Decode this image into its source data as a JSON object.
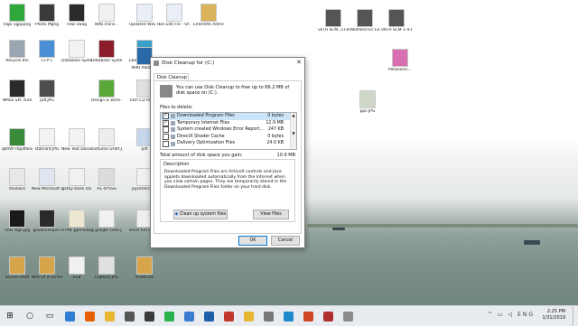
{
  "desktop": {
    "icons": [
      {
        "label": "logo vgpppng",
        "color": "#2ea83a"
      },
      {
        "label": "Photo Mgng",
        "color": "#3a3a3a"
      },
      {
        "label": "new vwag",
        "color": "#2b2b2b"
      },
      {
        "label": "WIKI.trans...",
        "color": "#f0f0f0"
      },
      {
        "label": "Updated Wiki File Name",
        "color": "#e9eef7"
      },
      {
        "label": "Do Edit Fle - Shortcut",
        "color": "#e9eef7"
      },
      {
        "label": "Enterkfts Admin ...",
        "color": "#d9b45a"
      },
      {
        "label": "Recycle Bin",
        "color": "#9aa6b2"
      },
      {
        "label": "CCP C",
        "color": "#4a8ed6"
      },
      {
        "label": "Database System.Srcs",
        "color": "#f3f3f3"
      },
      {
        "label": "Database System Ins",
        "color": "#8a1e2a"
      },
      {
        "label": "Ebay Web Help Info",
        "color": "#3aa0c8"
      },
      {
        "label": "WIKI Adobe...",
        "color": "#2b6aa8"
      },
      {
        "label": "NMSS SPI..ture",
        "color": "#2b2b2b"
      },
      {
        "label": "pdf.JPG",
        "color": "#4d4d4d"
      },
      {
        "label": "Design & work ec...",
        "color": "#5aa83a"
      },
      {
        "label": "Ebrl CD tech...",
        "color": "#e0e0e0"
      },
      {
        "label": "qkflVP mpdfanid...",
        "color": "#3a8a3a"
      },
      {
        "label": "statcont.JPG",
        "color": "#f3f3f3"
      },
      {
        "label": "New Text Document",
        "color": "#f3f3f3"
      },
      {
        "label": "costume Draft.JPG",
        "color": "#ededed"
      },
      {
        "label": "pdf",
        "color": "#c8d8ec"
      },
      {
        "label": "studiocs",
        "color": "#e8e8e8"
      },
      {
        "label": "New Microsoft W...",
        "color": "#dfe6f2"
      },
      {
        "label": "gstoy bank stu",
        "color": "#f0f0f0"
      },
      {
        "label": "A1-XYSSS",
        "color": "#dcdcdc"
      },
      {
        "label": "pyLmdcs stu",
        "color": "#f0f0f0"
      },
      {
        "label": "new logo.jpg",
        "color": "#1a1a1a"
      },
      {
        "label": "gsodeveloper.",
        "color": "#2a2a2a"
      },
      {
        "label": "HTML ppd tutorial",
        "color": "#ede6d0"
      },
      {
        "label": "g google code.JPG",
        "color": "#f0f0f0"
      },
      {
        "label": "short fun cd - File",
        "color": "#efefef"
      },
      {
        "label": "Screen Shot",
        "color": "#d6a44a"
      },
      {
        "label": "Ned Of it Screen Shot",
        "color": "#d6a44a"
      },
      {
        "label": "ECB",
        "color": "#f0f0f0"
      },
      {
        "label": "Capture.JPG",
        "color": "#e0e0e0"
      },
      {
        "label": "shortcuts",
        "color": "#d6a44a"
      },
      {
        "label": "vkTH SCM..3 FB (1-1...",
        "color": "#555"
      },
      {
        "label": "Modified Inc English gm...",
        "color": "#555"
      },
      {
        "label": "VKTH SCM 1-4-8 (B1...",
        "color": "#555"
      },
      {
        "label": "Pekasonic...",
        "color": "#d86fb0"
      },
      {
        "label": "ppc.JPG",
        "color": "#cfd8c8"
      }
    ]
  },
  "dialog": {
    "title": "Disk Cleanup for  (C:)",
    "tab": "Disk Cleanup",
    "info": "You can use Disk Cleanup to free up to 66.2 MB of disk space on  (C:).",
    "files_to_delete": "Files to delete:",
    "items": [
      {
        "label": "Downloaded Program Files",
        "size": "0 bytes",
        "checked": "✓"
      },
      {
        "label": "Temporary Internet Files",
        "size": "12.9 MB",
        "checked": "✓"
      },
      {
        "label": "System created Windows Error Report...",
        "size": "247 KB",
        "checked": ""
      },
      {
        "label": "DirectX Shader Cache",
        "size": "0 bytes",
        "checked": ""
      },
      {
        "label": "Delivery Optimization Files",
        "size": "24.0 KB",
        "checked": ""
      }
    ],
    "total_label": "Total amount of disk space you gain:",
    "total_value": "10.9 MB",
    "description_heading": "Description",
    "description": "Downloaded Program Files are ActiveX controls and Java applets downloaded automatically from the Internet when you view certain pages. They are temporarily stored in the Downloaded Program Files folder on your hard disk.",
    "cleanup_button": "Clean up system files",
    "view_button": "View Files",
    "ok": "OK",
    "cancel": "Cancel",
    "close_glyph": "✕"
  },
  "taskbar": {
    "start_glyph": "⊞",
    "search_glyph": "○",
    "task_glyph": "▭",
    "apps": [
      {
        "name": "edge",
        "color": "#2d7dd2"
      },
      {
        "name": "firefox",
        "color": "#e66000"
      },
      {
        "name": "explorer",
        "color": "#e8b531"
      },
      {
        "name": "calculator",
        "color": "#555555"
      },
      {
        "name": "store",
        "color": "#3a3a3a"
      },
      {
        "name": "camtasia",
        "color": "#2bb24c"
      },
      {
        "name": "recorder",
        "color": "#3a7ad0"
      },
      {
        "name": "photos",
        "color": "#1b5fa8"
      },
      {
        "name": "publisher",
        "color": "#c0392b"
      },
      {
        "name": "chrome",
        "color": "#e8b531"
      },
      {
        "name": "settings",
        "color": "#777777"
      },
      {
        "name": "tool",
        "color": "#1e88c8"
      },
      {
        "name": "powerpoint",
        "color": "#d04423"
      },
      {
        "name": "paint",
        "color": "#b03030"
      },
      {
        "name": "diskcleanup",
        "color": "#8a8a8a"
      }
    ],
    "tray": "^ ▭ ◁ ENG",
    "time": "2:25 PM",
    "date": "1/31/2019"
  }
}
